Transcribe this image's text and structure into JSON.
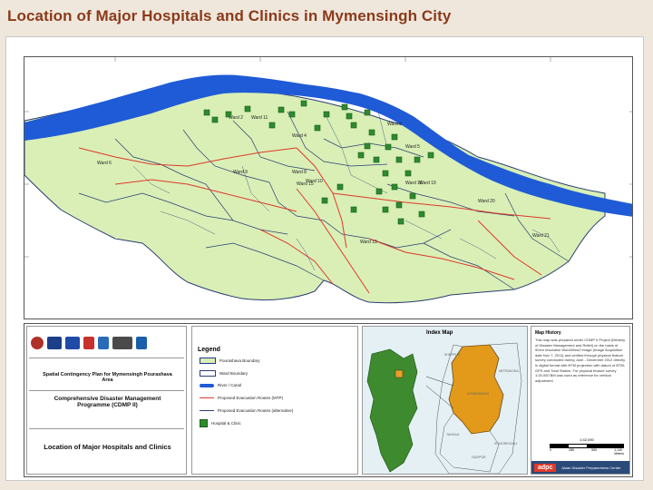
{
  "slide": {
    "title": "Location of Major Hospitals and Clinics in Mymensingh City"
  },
  "map": {
    "ward_labels": [
      "Ward 2",
      "Ward 3",
      "Ward 4",
      "Ward 5",
      "Ward 6",
      "Ward 8",
      "Ward 9",
      "Ward 10",
      "Ward 11",
      "Ward 13",
      "Ward 15",
      "Ward 16",
      "Ward 19",
      "Ward 20",
      "Ward 21"
    ],
    "colors": {
      "land": "#d9efb6",
      "river": "#1f5bd6",
      "roads": "#e0382b",
      "boundary": "#1f3a8a",
      "wards": "#2c3e73",
      "hospital": "#2f8a2f"
    }
  },
  "titleblock": {
    "plan_title": "Spatial Contingency Plan for Mymensingh Pourashava Area",
    "program_title": "Comprehensive Disaster Management Programme (CDMP II)",
    "map_title": "Location of Major Hospitals and Clinics"
  },
  "legend": {
    "title": "Legend",
    "items": [
      {
        "label": "Pourashava Boundary",
        "symbol": "boundary"
      },
      {
        "label": "Ward Boundary",
        "symbol": "ward"
      },
      {
        "label": "River / Canal",
        "symbol": "river"
      },
      {
        "label": "Proposed Evacuation Routes (MTP)",
        "symbol": "route"
      },
      {
        "label": "Proposed Evacuation Routes (alternative)",
        "symbol": "alt-route"
      },
      {
        "label": "Hospital & Clinic",
        "symbol": "hospital"
      }
    ]
  },
  "index_map": {
    "title": "Index Map",
    "labels": [
      "SHERPUR",
      "NETRAKONA",
      "MYMENSINGH",
      "TANGAIL",
      "KISHOREGANJ",
      "GAZIPUR"
    ]
  },
  "map_history": {
    "title": "Map History",
    "text": "This map was prepared under CDMP II Project (Ministry of Disaster Management and Relief) on the basis of 50cm resolution WorldView2 image (Image Acquisition date Nov 7, 2011) and verified through physical feature survey conducted during June - December 2012 directly in digital format with BTM projection with datum of BTM-GPS and Total Station. For physical feature survey 1:25,000 BM was used as reference for vertical adjustment.",
    "scale": "1:42,000",
    "scale_ticks": [
      "0",
      "285",
      "550",
      "1,140"
    ],
    "scale_unit": "Meters"
  },
  "organization": {
    "logo": "adpc",
    "name": "Asian Disaster Preparedness Center"
  }
}
